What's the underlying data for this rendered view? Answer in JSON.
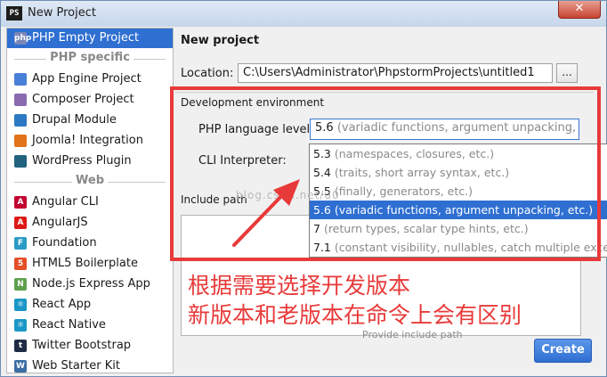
{
  "window": {
    "title": "New Project",
    "icon_text": "PS",
    "close_glyph": "✕"
  },
  "sidebar": {
    "items_top": [
      {
        "label": "PHP Empty Project",
        "icon": "php-file-icon",
        "icon_text": "php",
        "color": "#7a86b8",
        "selected": true
      }
    ],
    "php_specific_header": "PHP specific",
    "php_specific": [
      {
        "label": "App Engine Project",
        "icon": "app-engine-icon",
        "color": "#4a7fd8"
      },
      {
        "label": "Composer Project",
        "icon": "composer-icon",
        "color": "#8a6bb0"
      },
      {
        "label": "Drupal Module",
        "icon": "drupal-icon",
        "color": "#2b79c2"
      },
      {
        "label": "Joomla! Integration",
        "icon": "joomla-icon",
        "color": "#e2731a"
      },
      {
        "label": "WordPress Plugin",
        "icon": "wordpress-icon",
        "color": "#22627f"
      }
    ],
    "web_header": "Web",
    "web": [
      {
        "label": "Angular CLI",
        "icon": "angular-cli-icon",
        "icon_text": "A",
        "color": "#c3002f"
      },
      {
        "label": "AngularJS",
        "icon": "angularjs-icon",
        "icon_text": "A",
        "color": "#dd1b16"
      },
      {
        "label": "Foundation",
        "icon": "foundation-icon",
        "icon_text": "F",
        "color": "#2a9bc6"
      },
      {
        "label": "HTML5 Boilerplate",
        "icon": "html5-icon",
        "icon_text": "5",
        "color": "#e34f26"
      },
      {
        "label": "Node.js Express App",
        "icon": "nodejs-icon",
        "icon_text": "N",
        "color": "#5fa04e"
      },
      {
        "label": "React App",
        "icon": "react-icon",
        "icon_text": "⚛",
        "color": "#1b96c7"
      },
      {
        "label": "React Native",
        "icon": "react-native-icon",
        "icon_text": "⚛",
        "color": "#1b96c7"
      },
      {
        "label": "Twitter Bootstrap",
        "icon": "twitter-icon",
        "icon_text": "t",
        "color": "#1d2b44"
      },
      {
        "label": "Web Starter Kit",
        "icon": "web-starter-kit-icon",
        "icon_text": "W",
        "color": "#3a6ea5"
      }
    ]
  },
  "main": {
    "heading": "New project",
    "location_label": "Location:",
    "location_value": "C:\\Users\\Administrator\\PhpstormProjects\\untitled1",
    "browse_label": "...",
    "dev_env_title": "Development environment",
    "php_level_label": "PHP language level:",
    "php_level_value": "5.6",
    "php_level_hint": "(variadic functions, argument unpacking, etc.)",
    "cli_label": "CLI Interpreter:",
    "include_path_label": "Include path",
    "include_path_placeholder": "Provide include path",
    "create_button": "Create"
  },
  "dropdown": {
    "options": [
      {
        "version": "5.3",
        "hint": "(namespaces, closures, etc.)",
        "selected": false
      },
      {
        "version": "5.4",
        "hint": "(traits, short array syntax, etc.)",
        "selected": false
      },
      {
        "version": "5.5",
        "hint": "(finally, generators, etc.)",
        "selected": false
      },
      {
        "version": "5.6",
        "hint": "(variadic functions, argument unpacking, etc.)",
        "selected": true
      },
      {
        "version": "7",
        "hint": "(return types, scalar type hints, etc.)",
        "selected": false
      },
      {
        "version": "7.1",
        "hint": "(constant visibility, nullables, catch multiple exceptions, etc.)",
        "selected": false
      }
    ]
  },
  "annotation": {
    "line1": "根据需要选择开发版本",
    "line2": "新版本和老版本在命令上会有区别",
    "color": "#e83a3a",
    "watermark": "blog.csdn.net/u0"
  },
  "colors": {
    "accent": "#2f6fd2",
    "annotation_red": "#e83a3a"
  }
}
